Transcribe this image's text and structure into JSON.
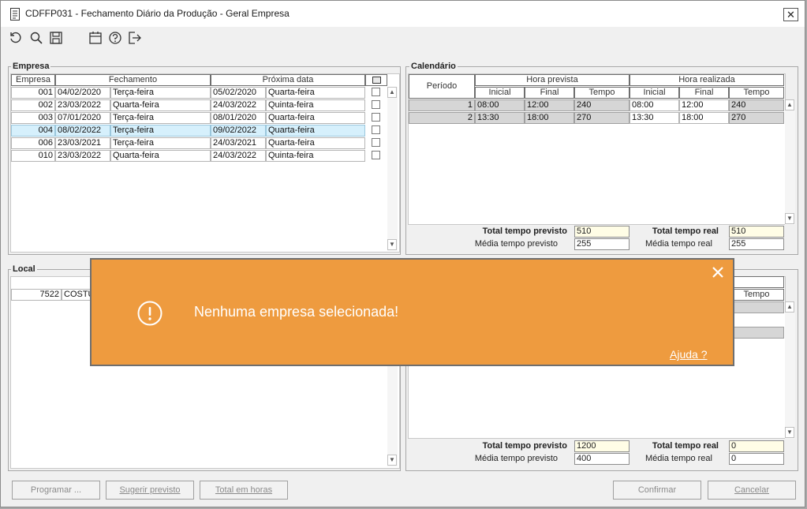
{
  "window": {
    "title": "CDFFP031 - Fechamento Diário da Produção - Geral Empresa",
    "close_glyph": "✕"
  },
  "toolbar": [
    "refresh-icon",
    "search-icon",
    "save-icon",
    "calendar-icon",
    "help-icon",
    "exit-icon"
  ],
  "empresa": {
    "title": "Empresa",
    "headers": [
      "Empresa",
      "Fechamento",
      "Próxima data"
    ],
    "rows": [
      {
        "code": "001",
        "date": "04/02/2020",
        "day": "Terça-feira",
        "next_date": "05/02/2020",
        "next_day": "Quarta-feira"
      },
      {
        "code": "002",
        "date": "23/03/2022",
        "day": "Quarta-feira",
        "next_date": "24/03/2022",
        "next_day": "Quinta-feira"
      },
      {
        "code": "003",
        "date": "07/01/2020",
        "day": "Terça-feira",
        "next_date": "08/01/2020",
        "next_day": "Quarta-feira"
      },
      {
        "code": "004",
        "date": "08/02/2022",
        "day": "Terça-feira",
        "next_date": "09/02/2022",
        "next_day": "Quarta-feira"
      },
      {
        "code": "006",
        "date": "23/03/2021",
        "day": "Terça-feira",
        "next_date": "24/03/2021",
        "next_day": "Quarta-feira"
      },
      {
        "code": "010",
        "date": "23/03/2022",
        "day": "Quarta-feira",
        "next_date": "24/03/2022",
        "next_day": "Quinta-feira"
      }
    ]
  },
  "calendario": {
    "title": "Calendário",
    "periodo": "Período",
    "hora_prevista": "Hora prevista",
    "hora_realizada": "Hora realizada",
    "sub": {
      "inicial": "Inicial",
      "final": "Final",
      "tempo": "Tempo"
    },
    "rows": [
      {
        "p": "1",
        "pi": "08:00",
        "pf": "12:00",
        "pt": "240",
        "ri": "08:00",
        "rf": "12:00",
        "rt": "240"
      },
      {
        "p": "2",
        "pi": "13:30",
        "pf": "18:00",
        "pt": "270",
        "ri": "13:30",
        "rf": "18:00",
        "rt": "270"
      }
    ],
    "total_previsto_label": "Total tempo previsto",
    "total_previsto": "510",
    "total_real_label": "Total tempo real",
    "total_real": "510",
    "media_previsto_label": "Média tempo previsto",
    "media_previsto": "255",
    "media_real_label": "Média tempo real",
    "media_real": "255"
  },
  "local": {
    "title": "Local",
    "row_code": "7522",
    "row_name": "COSTU",
    "tempo_header": "Tempo"
  },
  "local_calendar": {
    "total_previsto_label": "Total tempo previsto",
    "total_previsto": "1200",
    "total_real_label": "Total tempo real",
    "total_real": "0",
    "media_previsto_label": "Média tempo previsto",
    "media_previsto": "400",
    "media_real_label": "Média tempo real",
    "media_real": "0"
  },
  "buttons": {
    "programar": "Programar ...",
    "sugerir": "Sugerir previsto",
    "total_horas": "Total em horas",
    "confirmar": "Confirmar",
    "cancelar": "Cancelar"
  },
  "toast": {
    "message": "Nenhuma empresa selecionada!",
    "help": "Ajuda ?",
    "color": "#ee9b3f",
    "icon": "exclamation-circle-icon"
  }
}
